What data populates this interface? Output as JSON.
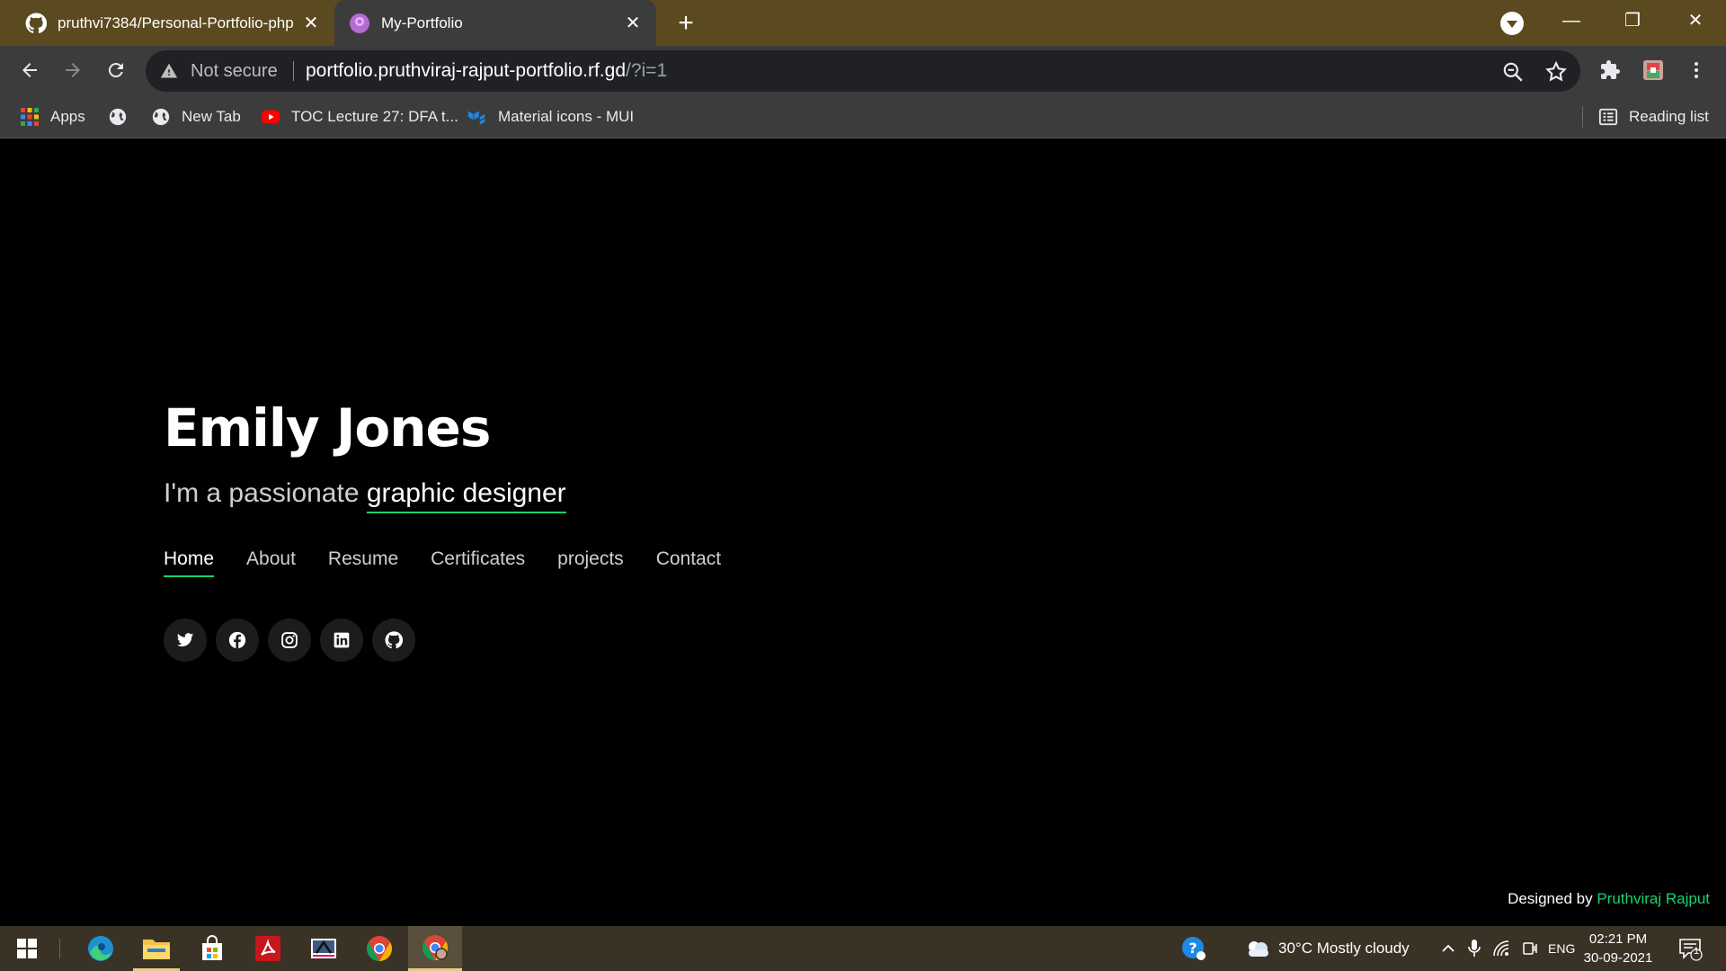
{
  "browser": {
    "tabs": [
      {
        "title": "pruthvi7384/Personal-Portfolio-php",
        "icon": "github-icon",
        "active": false
      },
      {
        "title": "My-Portfolio",
        "icon": "portfolio-favicon-icon",
        "active": true
      }
    ],
    "new_tab_label": "+",
    "omnibox": {
      "security_label": "Not secure",
      "url_main": "portfolio.pruthviraj-rajput-portfolio.rf.gd",
      "url_rest": "/?i=1"
    },
    "bookmarks": [
      {
        "label": "Apps",
        "icon": "apps-grid-icon"
      },
      {
        "label": "",
        "icon": "globe-icon"
      },
      {
        "label": "New Tab",
        "icon": "globe-icon"
      },
      {
        "label": "TOC Lecture 27: DFA t...",
        "icon": "youtube-icon"
      },
      {
        "label": "Material icons - MUI",
        "icon": "mui-icon"
      }
    ],
    "reading_list_label": "Reading list"
  },
  "page": {
    "name": "Emily Jones",
    "subtitle_prefix": "I'm a passionate",
    "subtitle_typed": "graphic designer",
    "nav": [
      "Home",
      "About",
      "Resume",
      "Certificates",
      "projects",
      "Contact"
    ],
    "active_nav": "Home",
    "socials": [
      "twitter-icon",
      "facebook-icon",
      "instagram-icon",
      "linkedin-icon",
      "github-icon"
    ],
    "footer_prefix": "Designed by",
    "footer_link": "Pruthviraj Rajput"
  },
  "taskbar": {
    "weather": "30°C  Mostly cloudy",
    "language": "ENG",
    "time": "02:21 PM",
    "date": "30-09-2021",
    "notification_count": "1"
  },
  "colors": {
    "accent": "#18d26e",
    "titlebar": "#5b4a1f",
    "toolbar": "#3c3c3c",
    "taskbar": "#3b3226"
  }
}
